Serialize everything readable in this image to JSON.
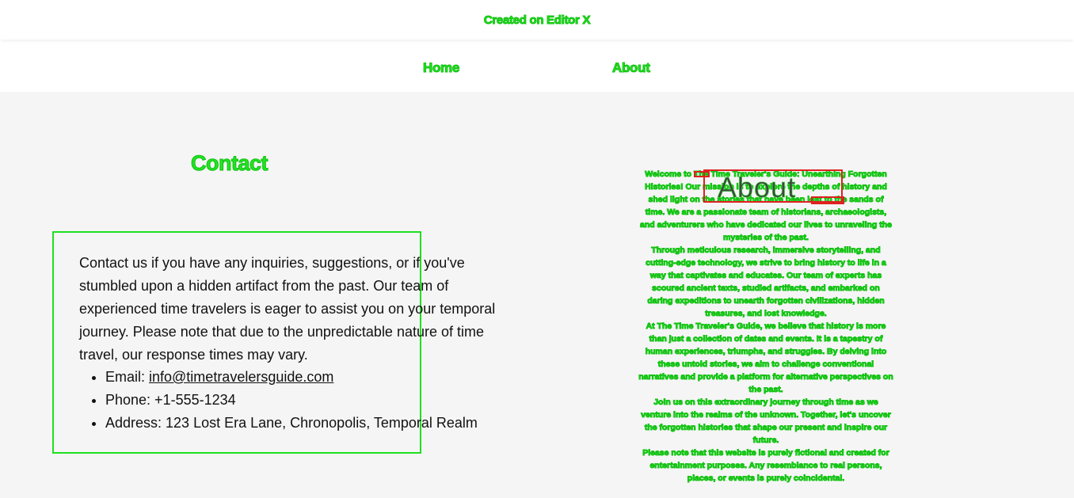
{
  "banner": {
    "text": "Created on Editor X"
  },
  "nav": {
    "items": [
      {
        "label": "Home"
      },
      {
        "label": "About"
      }
    ]
  },
  "contact": {
    "title": "Contact",
    "intro": "Contact us if you have any inquiries, suggestions, or if you've stumbled upon a hidden artifact from the past. Our team of experienced time travelers is eager to assist you on your temporal journey. Please note that due to the unpredictable nature of time travel, our response times may vary.",
    "email_label": "Email: ",
    "email": "info@timetravelersguide.com",
    "phone": "Phone: +1-555-1234",
    "address": "Address: 123 Lost Era Lane, Chronopolis, Temporal Realm"
  },
  "about": {
    "title": "About",
    "paragraphs": [
      "Welcome to The Time Traveler's Guide: Unearthing Forgotten Histories! Our mission is to explore the depths of history and shed light on the stories that have been lost to the sands of time. We are a passionate team of historians, archaeologists, and adventurers who have dedicated our lives to unraveling the mysteries of the past.",
      "Through meticulous research, immersive storytelling, and cutting-edge technology, we strive to bring history to life in a way that captivates and educates. Our team of experts has scoured ancient texts, studied artifacts, and embarked on daring expeditions to unearth forgotten civilizations, hidden treasures, and lost knowledge.",
      "At The Time Traveler's Guide, we believe that history is more than just a collection of dates and events. It is a tapestry of human experiences, triumphs, and struggles. By delving into these untold stories, we aim to challenge conventional narratives and provide a platform for alternative perspectives on the past.",
      "Join us on this extraordinary journey through time as we venture into the realms of the unknown. Together, let's uncover the forgotten histories that shape our present and inspire our future.",
      "Please note that this website is purely fictional and created for entertainment purposes. Any resemblance to real persons, places, or events is purely coincidental."
    ]
  },
  "colors": {
    "accent": "#22e422",
    "marker": "#e02020",
    "background": "#f5f5f5"
  }
}
